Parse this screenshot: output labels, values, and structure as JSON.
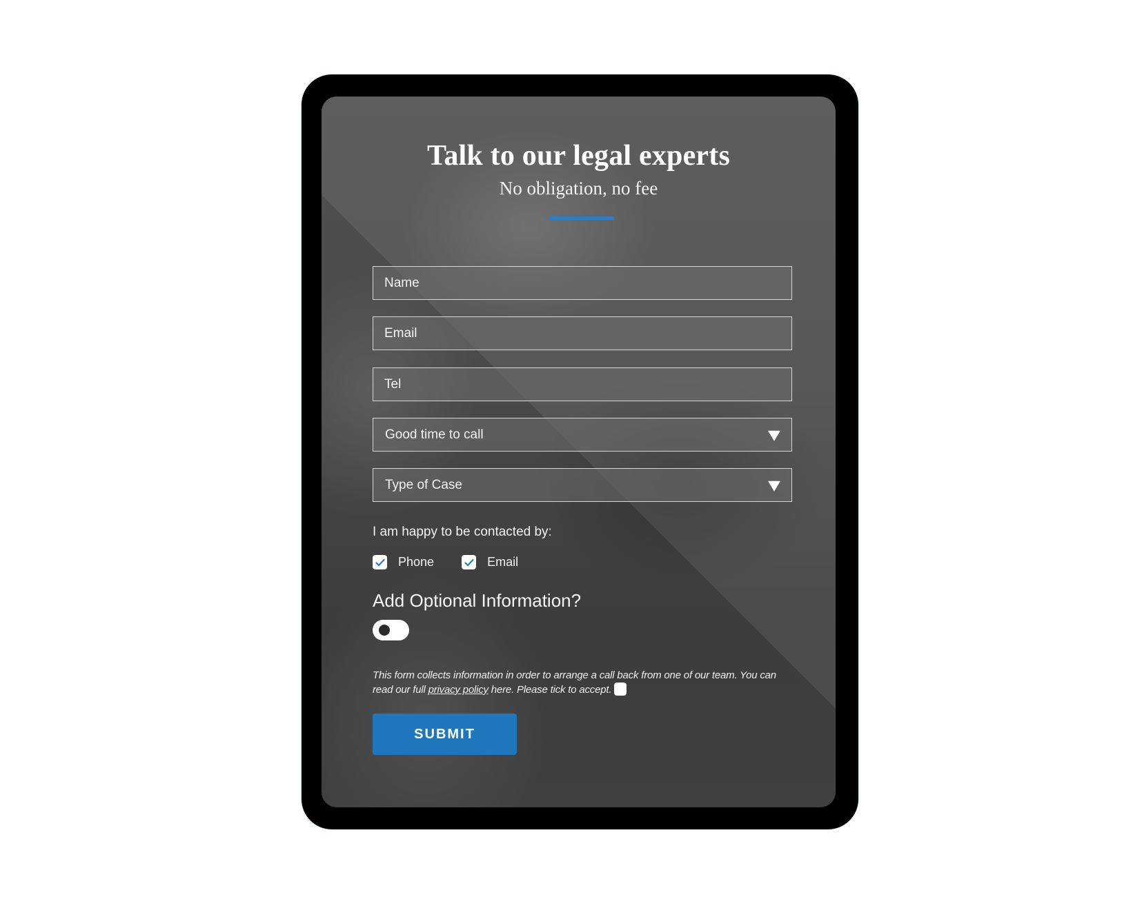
{
  "form": {
    "title": "Talk to our legal experts",
    "subtitle": "No obligation, no fee",
    "accent_color": "#2e7dc4",
    "fields": {
      "name": {
        "placeholder": "Name",
        "value": ""
      },
      "email": {
        "placeholder": "Email",
        "value": ""
      },
      "tel": {
        "placeholder": "Tel",
        "value": ""
      }
    },
    "selects": {
      "good_time": {
        "selected": "Good time to call"
      },
      "case_type": {
        "selected": "Type of Case"
      }
    },
    "contact": {
      "label": "I am happy to be contacted by:",
      "options": [
        {
          "label": "Phone",
          "checked": true
        },
        {
          "label": "Email",
          "checked": true
        }
      ]
    },
    "optional": {
      "label": "Add Optional Information?",
      "toggle_on": false
    },
    "consent": {
      "text_before": "This form collects information in order to arrange a call back from one of our team. You can read our full ",
      "link_text": "privacy policy",
      "text_after": " here. Please tick to accept.",
      "checked": false
    },
    "submit_label": "SUBMIT",
    "submit_color": "#1f77be"
  }
}
